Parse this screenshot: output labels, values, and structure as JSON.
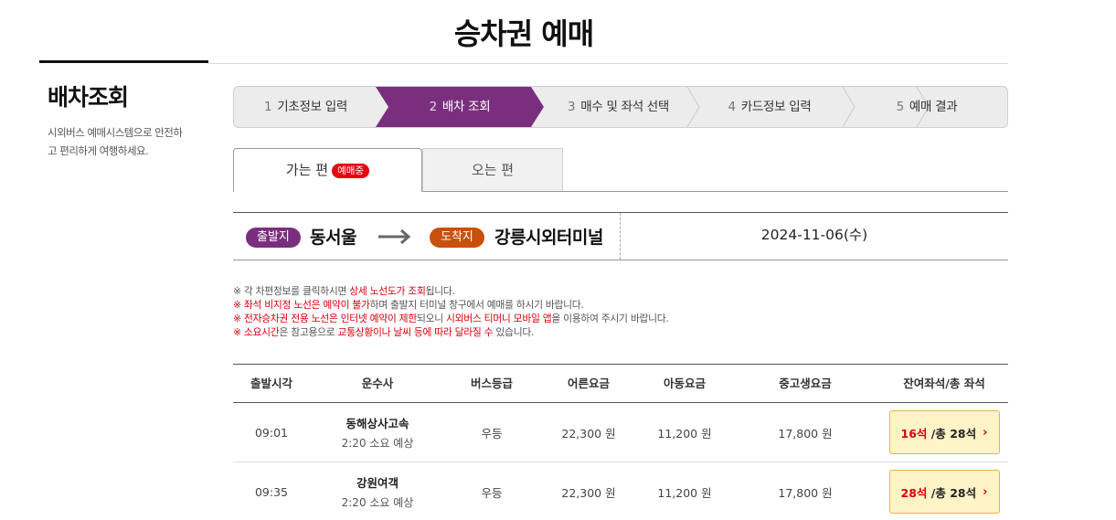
{
  "page": {
    "title": "승차권 예매"
  },
  "sidebar": {
    "title": "배차조회",
    "desc_line1": "시외버스 예매시스템으로 안전하",
    "desc_line2": "고 편리하게 여행하세요."
  },
  "steps": [
    {
      "num": "1",
      "label": "기초정보 입력"
    },
    {
      "num": "2",
      "label": "배차 조회"
    },
    {
      "num": "3",
      "label": "매수 및 좌석 선택"
    },
    {
      "num": "4",
      "label": "카드정보 입력"
    },
    {
      "num": "5",
      "label": "예매 결과"
    }
  ],
  "active_step": 2,
  "tabs": {
    "outbound": "가는 편",
    "outbound_badge": "예매중",
    "return": "오는 편"
  },
  "route": {
    "departure_label": "출발지",
    "departure": "동서울",
    "arrival_label": "도착지",
    "arrival": "강릉시외터미널",
    "date": "2024-11-06(수)"
  },
  "notes": {
    "line1": {
      "a": "※ 각 차편정보를 클릭하시면 ",
      "b": "상세 노선도가 조회",
      "c": "됩니다."
    },
    "line2": {
      "a": "※ ",
      "b": "좌석 비지정 노선은 예약이 불가",
      "c": "하며 출발지 터미널 창구에서 예매를 하시기 바랍니다."
    },
    "line3": {
      "a": "※ ",
      "b": "전자승차권 전용 노선은 인터넷 예약이 제한",
      "c": "되오니 ",
      "d": "시외버스 티머니 모바일 앱",
      "e": "을 이용하여 주시기 바랍니다."
    },
    "line4": {
      "a": "※ ",
      "b": "소요시간",
      "c": "은 참고용으로 ",
      "d": "교통상황이나 날씨 등에 따라 달라질 수",
      "e": " 있습니다."
    }
  },
  "table": {
    "headers": [
      "출발시각",
      "운수사",
      "버스등급",
      "어른요금",
      "아동요금",
      "중고생요금",
      "잔여좌석/총 좌석"
    ],
    "rows": [
      {
        "time": "09:01",
        "company": "동해상사고속",
        "duration": "2:20 소요 예상",
        "grade": "우등",
        "adult": "22,300 원",
        "child": "11,200 원",
        "student": "17,800 원",
        "remain": "16석",
        "total": "/총 28석"
      },
      {
        "time": "09:35",
        "company": "강원여객",
        "duration": "2:20 소요 예상",
        "grade": "우등",
        "adult": "22,300 원",
        "child": "11,200 원",
        "student": "17,800 원",
        "remain": "28석",
        "total": "/총 28석"
      }
    ]
  },
  "colors": {
    "accent_purple": "#7a2f7e",
    "arrival_orange": "#c8500c",
    "highlight_red": "#d9000d",
    "seat_button_bg": "#fff3c8"
  }
}
